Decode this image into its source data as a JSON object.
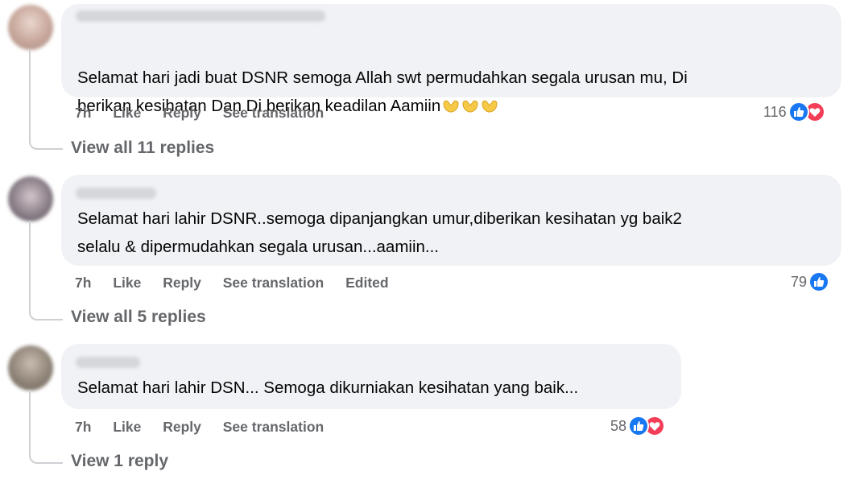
{
  "comments": [
    {
      "text": "Selamat hari jadi buat DSNR semoga Allah swt permudahkan segala urusan mu, Di\nberikan kesihatan Dan Di berikan keadilan Aamiin",
      "time": "7h",
      "like_label": "Like",
      "reply_label": "Reply",
      "translate_label": "See translation",
      "reaction_count": "116",
      "reactions": [
        "like-icon",
        "love-icon"
      ],
      "emojis": [
        "palms-up-together",
        "palms-up-together",
        "palms-up-together"
      ],
      "view_replies": "View all 11 replies"
    },
    {
      "text": "Selamat hari lahir DSNR..semoga dipanjangkan umur,diberikan kesihatan yg baik2\nselalu & dipermudahkan segala urusan...aamiin...",
      "time": "7h",
      "like_label": "Like",
      "reply_label": "Reply",
      "translate_label": "See translation",
      "edited_label": "Edited",
      "reaction_count": "79",
      "reactions": [
        "like-icon"
      ],
      "view_replies": "View all 5 replies"
    },
    {
      "text": "Selamat hari lahir DSN... Semoga dikurniakan kesihatan yang baik...",
      "time": "7h",
      "like_label": "Like",
      "reply_label": "Reply",
      "translate_label": "See translation",
      "reaction_count": "58",
      "reactions": [
        "like-icon",
        "love-icon"
      ],
      "view_replies": "View 1 reply"
    }
  ],
  "colors": {
    "bubble": "#f0f2f5",
    "secondary_text": "#65676b",
    "like_blue": "#1877f2",
    "love_red": "#f33e58",
    "emoji_yellow": "#f7c948"
  }
}
